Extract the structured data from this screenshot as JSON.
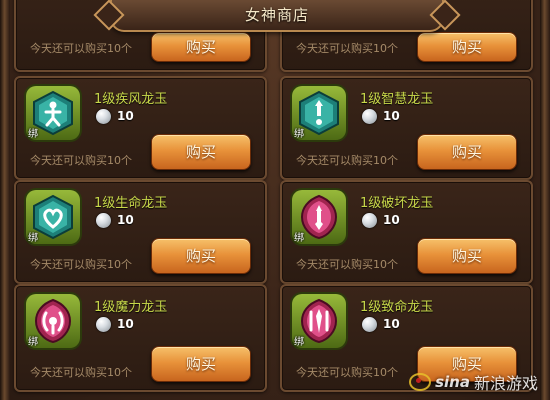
{
  "shop": {
    "title": "女神商店"
  },
  "partial_row": [
    {
      "limit": "今天还可以购买10个",
      "buy_label": "购买"
    },
    {
      "limit": "今天还可以购买10个",
      "buy_label": "购买"
    }
  ],
  "items": [
    {
      "name": "1级疾风龙玉",
      "price": "10",
      "bind_tag": "绑",
      "limit": "今天还可以购买10个",
      "buy_label": "购买",
      "icon": "gale-jade-icon",
      "gem_color": "#2fa39a"
    },
    {
      "name": "1级智慧龙玉",
      "price": "10",
      "bind_tag": "绑",
      "limit": "今天还可以购买10个",
      "buy_label": "购买",
      "icon": "wisdom-jade-icon",
      "gem_color": "#2fa39a"
    },
    {
      "name": "1级生命龙玉",
      "price": "10",
      "bind_tag": "绑",
      "limit": "今天还可以购买10个",
      "buy_label": "购买",
      "icon": "life-jade-icon",
      "gem_color": "#2fa39a"
    },
    {
      "name": "1级破坏龙玉",
      "price": "10",
      "bind_tag": "绑",
      "limit": "今天还可以购买10个",
      "buy_label": "购买",
      "icon": "destruction-jade-icon",
      "gem_color": "#c8336a"
    },
    {
      "name": "1级魔力龙玉",
      "price": "10",
      "bind_tag": "绑",
      "limit": "今天还可以购买10个",
      "buy_label": "购买",
      "icon": "magic-jade-icon",
      "gem_color": "#c8336a"
    },
    {
      "name": "1级致命龙玉",
      "price": "10",
      "bind_tag": "绑",
      "limit": "今天还可以购买10个",
      "buy_label": "购买",
      "icon": "lethal-jade-icon",
      "gem_color": "#c8336a"
    }
  ],
  "currency_icon": "pearl-icon",
  "watermark": {
    "brand": "sina",
    "text": "新浪游戏"
  }
}
